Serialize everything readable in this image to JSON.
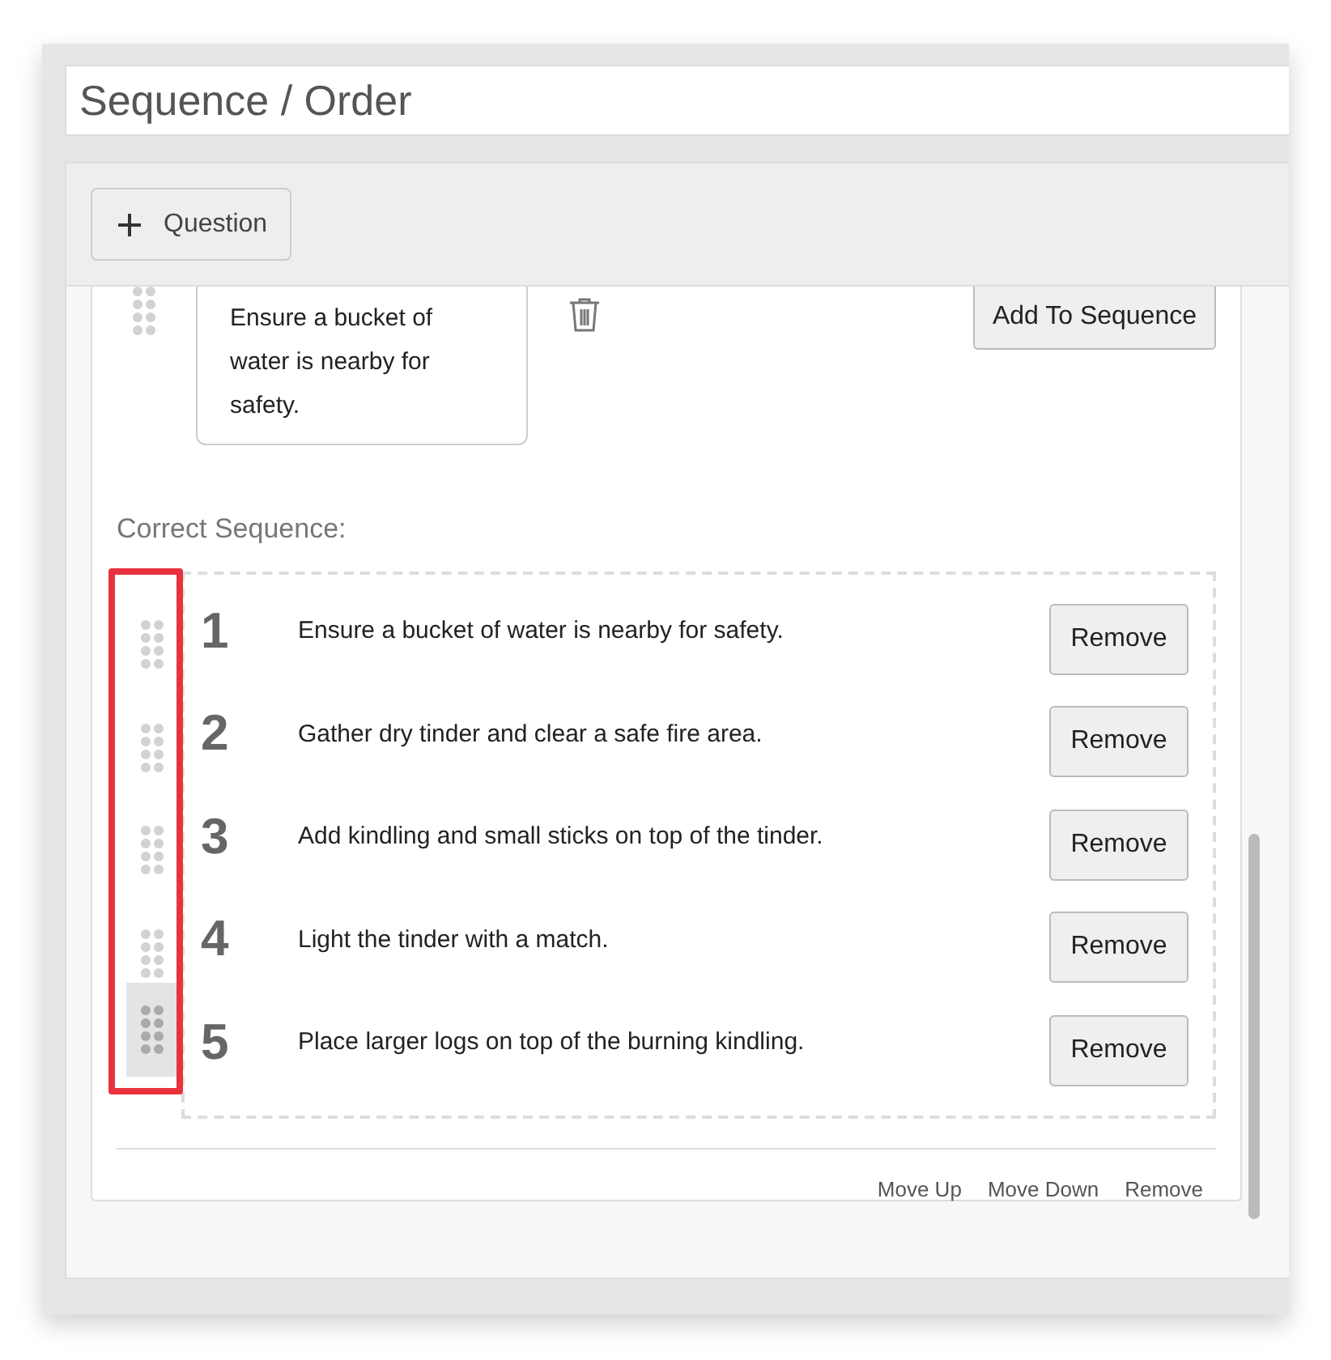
{
  "title_field": {
    "value": "Sequence / Order"
  },
  "toolbar": {
    "add_question_button": {
      "label": "Question"
    }
  },
  "pending_item": {
    "text": "Ensure a bucket of water is nearby for safety.",
    "add_button": "Add To Sequence"
  },
  "correct_sequence": {
    "label": "Correct Sequence:",
    "handles_highlighted": true,
    "items": [
      {
        "number": "1",
        "text": "Ensure a bucket of water is nearby for safety.",
        "remove": "Remove",
        "hovered": false
      },
      {
        "number": "2",
        "text": "Gather dry tinder and clear a safe fire area.",
        "remove": "Remove",
        "hovered": false
      },
      {
        "number": "3",
        "text": "Add kindling and small sticks on top of the tinder.",
        "remove": "Remove",
        "hovered": false
      },
      {
        "number": "4",
        "text": "Light the tinder with a match.",
        "remove": "Remove",
        "hovered": false
      },
      {
        "number": "5",
        "text": "Place larger logs on top of the burning kindling.",
        "remove": "Remove",
        "hovered": true
      }
    ]
  },
  "footer_actions": [
    "Move Up",
    "Move Down",
    "Remove"
  ]
}
